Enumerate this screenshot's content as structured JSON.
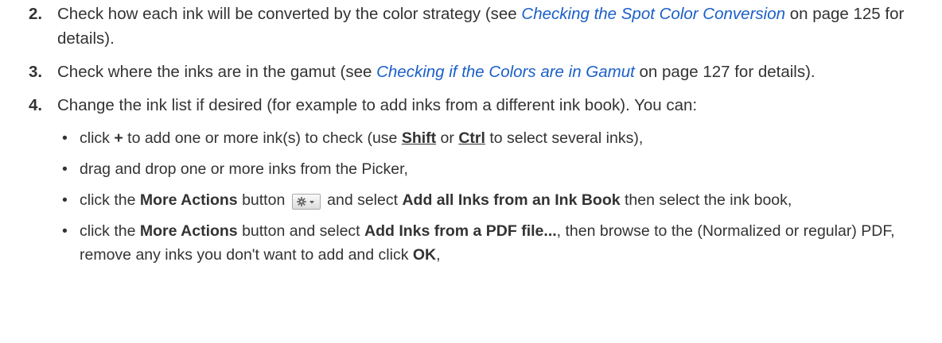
{
  "steps": [
    {
      "number": "2.",
      "before": "Check how each ink will be converted by the color strategy (see ",
      "link": "Checking the Spot Color Conversion",
      "after": " on page 125 for details)."
    },
    {
      "number": "3.",
      "before": "Check where the inks are in the gamut (see ",
      "link": "Checking if the Colors are in Gamut",
      "after": " on page 127 for details)."
    },
    {
      "number": "4.",
      "text": "Change the ink list if desired (for example to add inks from a different ink book). You can:"
    }
  ],
  "bullets": {
    "symbol": "•",
    "item1": {
      "t1": "click ",
      "plus": "+",
      "t2": " to add one or more ink(s) to check (use ",
      "shift": "Shift",
      "t3": " or ",
      "ctrl": "Ctrl",
      "t4": " to select several inks),"
    },
    "item2": {
      "text": "drag and drop one or more inks from the Picker,"
    },
    "item3": {
      "t1": "click the ",
      "more_actions": "More Actions",
      "t2": " button ",
      "t3": " and select ",
      "add_all": "Add all Inks from an Ink Book",
      "t4": " then select the ink book,"
    },
    "item4": {
      "t1": "click the ",
      "more_actions": "More Actions",
      "t2": " button and select ",
      "add_pdf": "Add Inks from a PDF file...",
      "t3": ", then browse to the (Normalized or regular) PDF, remove any inks you don't want to add and click ",
      "ok": "OK",
      "t4": ","
    }
  },
  "icons": {
    "more_actions_button": "gear-dropdown-icon"
  },
  "colors": {
    "link": "#1a5fc8",
    "text": "#333333"
  }
}
